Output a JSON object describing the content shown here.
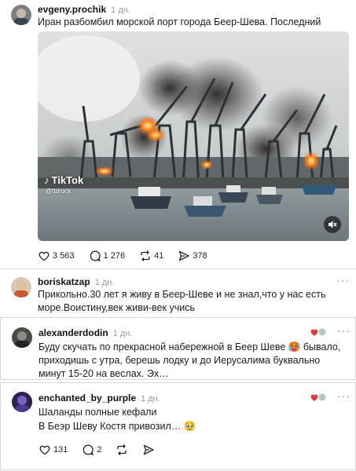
{
  "post": {
    "username": "evgeny.prochik",
    "time": "1 дн.",
    "text": "Иран разбомбил морской порт города Беер-Шева. Последний оплот пал.",
    "video_watermark": "TikTok",
    "video_handle": "@ttdrock",
    "likes": "3 563",
    "comments": "1 276",
    "reposts": "41",
    "shares": "378"
  },
  "replies": [
    {
      "username": "boriskatzap",
      "time": "1 дн.",
      "text": "Прикольно.30 лет я живу в Беер-Шеве и не знал,что у нас есть море.Воистину,век живи-век учись"
    },
    {
      "username": "alexanderdodin",
      "time": "1 дн.",
      "text": "Буду скучать по прекрасной набережной в Беер Шеве 🥵 бывало, приходишь с утра, берешь лодку и до Иерусалима буквально минут 15-20 на веслах. Эх…"
    },
    {
      "username": "enchanted_by_purple",
      "time": "1 дн.",
      "text_line1": "Шаланды полные кефали",
      "text_line2": "В Беэр Шеву Костя привозил… 🥹",
      "likes": "131",
      "comments": "2"
    }
  ],
  "icons": {
    "like": "heart-icon",
    "comment": "comment-bubble-icon",
    "repost": "repost-icon",
    "share": "send-icon",
    "more": "more-dots-icon",
    "mute": "speaker-muted-icon"
  },
  "colors": {
    "username": "#111111",
    "time": "#9a9a9a",
    "border": "#d8d8d8",
    "fire": "#ff6a13"
  }
}
